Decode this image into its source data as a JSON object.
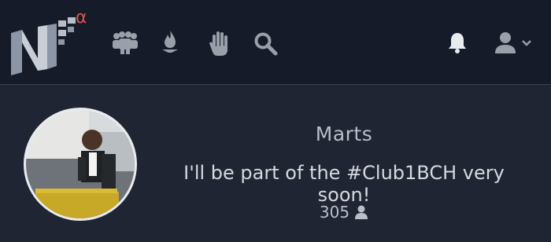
{
  "brand": {
    "beta_mark": "α"
  },
  "nav": {
    "icons": [
      "community-icon",
      "trending-fire-icon",
      "hand-icon",
      "search-icon"
    ],
    "right_icons": [
      "bell-icon",
      "user-icon",
      "chevron-down-icon"
    ]
  },
  "profile": {
    "name": "Marts",
    "bio": "I'll be part of the #Club1BCH very soon!",
    "followers_count": "305"
  },
  "colors": {
    "navbar_bg": "#151b29",
    "page_bg": "#1f2533",
    "icon": "#9aa0aa",
    "beta_red": "#d9534f"
  }
}
